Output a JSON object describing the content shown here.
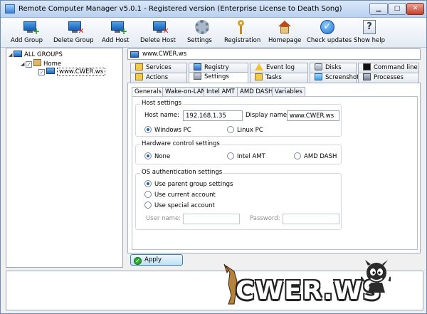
{
  "window": {
    "title": "Remote Computer Manager v5.0.1 - Registered version (Enterprise License to Death Song)"
  },
  "toolbar": {
    "buttons": [
      {
        "label": "Add Group",
        "icon": "add-group-icon"
      },
      {
        "label": "Delete Group",
        "icon": "delete-group-icon"
      },
      {
        "label": "Add Host",
        "icon": "add-host-icon"
      },
      {
        "label": "Delete Host",
        "icon": "delete-host-icon"
      },
      {
        "label": "Settings",
        "icon": "gear-icon"
      },
      {
        "label": "Registration",
        "icon": "key-icon"
      },
      {
        "label": "Homepage",
        "icon": "home-icon"
      },
      {
        "label": "Check updates",
        "icon": "check-icon"
      },
      {
        "label": "Show help",
        "icon": "help-icon"
      }
    ]
  },
  "tree": {
    "root": "ALL GROUPS",
    "group": "Home",
    "host": "www.CWER.ws"
  },
  "host_header": "www.CWER.ws",
  "tabs": {
    "row1": [
      "Services",
      "Registry",
      "Event log",
      "Disks",
      "Command line"
    ],
    "row2": [
      "Actions",
      "Settings",
      "Tasks",
      "Screenshot",
      "Processes"
    ],
    "active": "Settings"
  },
  "subtabs": {
    "items": [
      "Generals",
      "Wake-on-LAN",
      "Intel AMT",
      "AMD DASH",
      "Variables"
    ],
    "active": "Generals"
  },
  "host_settings": {
    "title": "Host settings",
    "host_name_label": "Host name:",
    "host_name_value": "192.168.1.35",
    "display_name_label": "Display name:",
    "display_name_value": "www.CWER.ws",
    "os_options": [
      "Windows PC",
      "Linux PC"
    ],
    "os_selected": "Windows PC"
  },
  "hardware_control": {
    "title": "Hardware control settings",
    "options": [
      "None",
      "Intel AMT",
      "AMD DASH"
    ],
    "selected": "None"
  },
  "os_auth": {
    "title": "OS authentication settings",
    "options": [
      "Use parent group settings",
      "Use current account",
      "Use special account"
    ],
    "selected": "Use parent group settings",
    "user_label": "User name:",
    "password_label": "Password:"
  },
  "apply_label": "Apply",
  "watermark": "CWER.WS",
  "colors": {
    "accent": "#1e5fb8",
    "titlebar": "#b9d1ee",
    "close": "#c6402c"
  }
}
